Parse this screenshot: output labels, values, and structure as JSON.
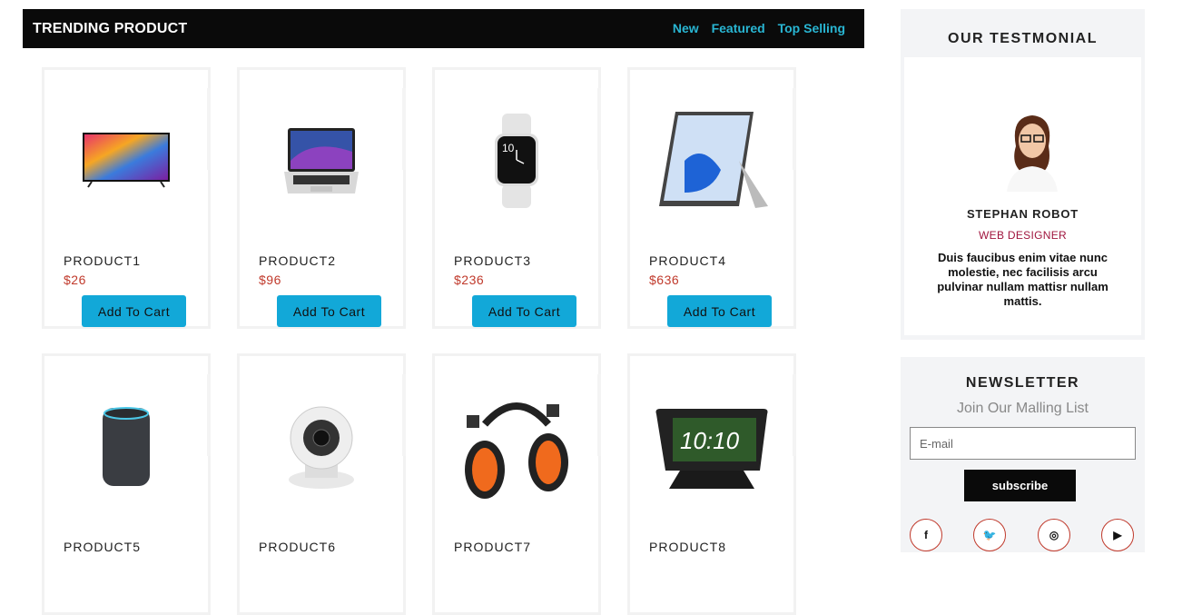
{
  "trending": {
    "title": "TRENDING PRODUCT",
    "tabs": [
      "New",
      "Featured",
      "Top Selling"
    ]
  },
  "products": [
    {
      "name": "PRODUCT1",
      "price": "$26",
      "button": "Add To Cart",
      "icon": "tv-icon"
    },
    {
      "name": "PRODUCT2",
      "price": "$96",
      "button": "Add To Cart",
      "icon": "laptop-icon"
    },
    {
      "name": "PRODUCT3",
      "price": "$236",
      "button": "Add To Cart",
      "icon": "smartwatch-icon"
    },
    {
      "name": "PRODUCT4",
      "price": "$636",
      "button": "Add To Cart",
      "icon": "tablet-icon"
    },
    {
      "name": "PRODUCT5",
      "price": "",
      "button": "",
      "icon": "smart-speaker-icon"
    },
    {
      "name": "PRODUCT6",
      "price": "",
      "button": "",
      "icon": "security-camera-icon"
    },
    {
      "name": "PRODUCT7",
      "price": "",
      "button": "",
      "icon": "earmuffs-icon"
    },
    {
      "name": "PRODUCT8",
      "price": "",
      "button": "",
      "icon": "smart-display-icon"
    }
  ],
  "testimonial": {
    "heading": "OUR TESTMONIAL",
    "name": "STEPHAN ROBOT",
    "role": "WEB DESIGNER",
    "quote": "Duis faucibus enim vitae nunc molestie, nec facilisis arcu pulvinar nullam mattisr nullam mattis."
  },
  "newsletter": {
    "heading": "NEWSLETTER",
    "subheading": "Join Our Malling List",
    "email_placeholder": "E-mail",
    "subscribe_label": "subscribe",
    "socials": [
      {
        "icon": "facebook-icon",
        "glyph": "f"
      },
      {
        "icon": "twitter-icon",
        "glyph": "🐦"
      },
      {
        "icon": "instagram-icon",
        "glyph": "◎"
      },
      {
        "icon": "youtube-icon",
        "glyph": "▶"
      }
    ]
  },
  "colors": {
    "accent_button": "#12a8d8",
    "tab_link": "#29b6d3",
    "price": "#c0392b",
    "role": "#a0153e",
    "bar_bg": "#0a0a0a"
  }
}
